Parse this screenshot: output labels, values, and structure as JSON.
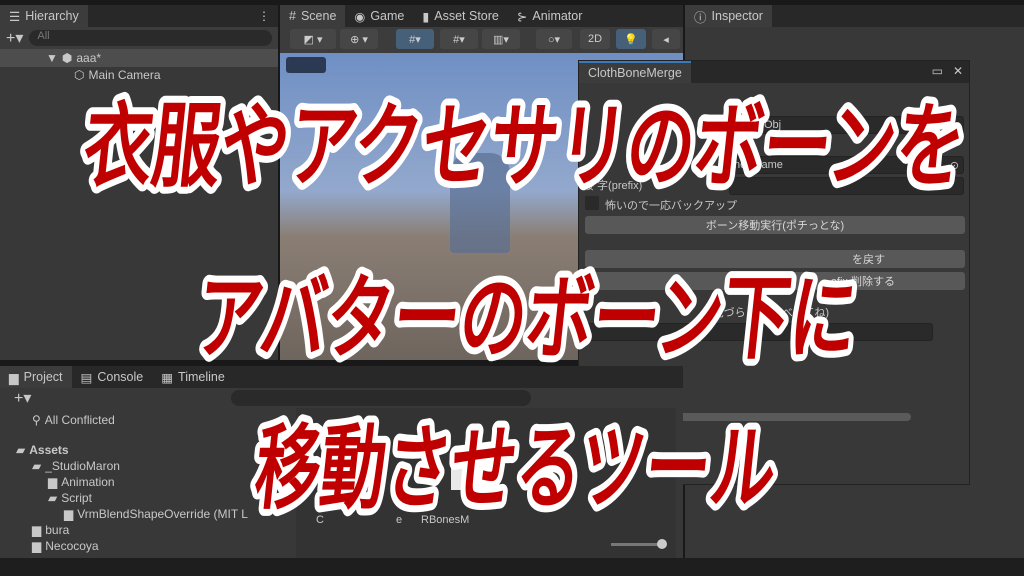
{
  "hierarchy": {
    "tab": "Hierarchy",
    "search_placeholder": "All",
    "scene": "aaa*",
    "items": [
      "Main Camera"
    ]
  },
  "scene_tabs": [
    {
      "label": "Scene",
      "icon": "hash-icon"
    },
    {
      "label": "Game",
      "icon": "gamepad-icon"
    },
    {
      "label": "Asset Store",
      "icon": "bag-icon"
    },
    {
      "label": "Animator",
      "icon": "animator-icon"
    }
  ],
  "scene_toolbar": {
    "mode_2d": "2D"
  },
  "inspector": {
    "tab": "Inspector"
  },
  "tool_window": {
    "title": "ClothBoneMerge",
    "object_field_1": "Obj",
    "object_field_2": "ne (Game",
    "prefix_label": "接 字(prefix)",
    "backup_label": "怖いので一応バックアップ",
    "backup_checked": false,
    "run_button": "ボーン移動実行(ポチっとな)",
    "restore_button": "を戻す",
    "delete_button": "efix  削除する",
    "note": "(見づら 篇に並べしてね)"
  },
  "project": {
    "tabs": [
      "Project",
      "Console",
      "Timeline"
    ],
    "tree": [
      {
        "label": "All Conflicted",
        "depth": 1,
        "icon": "search-icon"
      },
      {
        "label": "Assets",
        "depth": 0,
        "icon": "folder-open-icon",
        "bold": true
      },
      {
        "label": "_StudioMaron",
        "depth": 1,
        "icon": "folder-open-icon"
      },
      {
        "label": "Animation",
        "depth": 2,
        "icon": "folder-icon"
      },
      {
        "label": "Script",
        "depth": 2,
        "icon": "folder-open-icon"
      },
      {
        "label": "VrmBlendShapeOverride (MIT L",
        "depth": 3,
        "icon": "folder-icon"
      },
      {
        "label": "bura",
        "depth": 1,
        "icon": "folder-icon"
      },
      {
        "label": "Necocoya",
        "depth": 1,
        "icon": "folder-icon"
      }
    ],
    "assets": [
      "C",
      "e",
      "RBonesM"
    ]
  },
  "overlay": {
    "lines": [
      "衣服やアクセサリのボーンを",
      "アバターのボーン下に",
      "移動させるツール"
    ],
    "fill": "#c00000",
    "stroke": "#ffffff"
  }
}
